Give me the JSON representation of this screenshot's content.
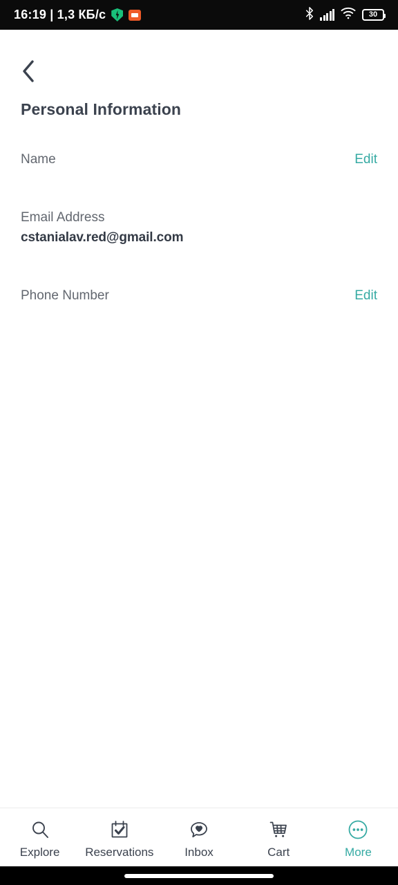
{
  "status_bar": {
    "clock": "16:19 | 1,3 КБ/с",
    "battery_level": "30",
    "icons": [
      "shield-icon",
      "orange-app-icon",
      "bluetooth-icon",
      "signal-icon",
      "wifi-icon",
      "battery-icon"
    ]
  },
  "header": {
    "back_icon": "chevron-left-icon",
    "title": "Personal Information"
  },
  "fields": [
    {
      "label": "Name",
      "value": "",
      "action": "Edit",
      "has_action": true
    },
    {
      "label": "Email Address",
      "value": "cstanialav.red@gmail.com",
      "action": "",
      "has_action": false
    },
    {
      "label": "Phone Number",
      "value": "",
      "action": "Edit",
      "has_action": true
    }
  ],
  "bottom_nav": {
    "items": [
      {
        "label": "Explore",
        "icon": "search-icon",
        "active": false
      },
      {
        "label": "Reservations",
        "icon": "calendar-check-icon",
        "active": false
      },
      {
        "label": "Inbox",
        "icon": "chat-heart-icon",
        "active": false
      },
      {
        "label": "Cart",
        "icon": "shopping-cart-icon",
        "active": false
      },
      {
        "label": "More",
        "icon": "more-circle-icon",
        "active": true
      }
    ]
  },
  "colors": {
    "accent": "#35aaa3",
    "title": "#3b424e",
    "label": "#62676f",
    "value": "#333a45",
    "status_bar_bg": "#0b0b0b"
  }
}
